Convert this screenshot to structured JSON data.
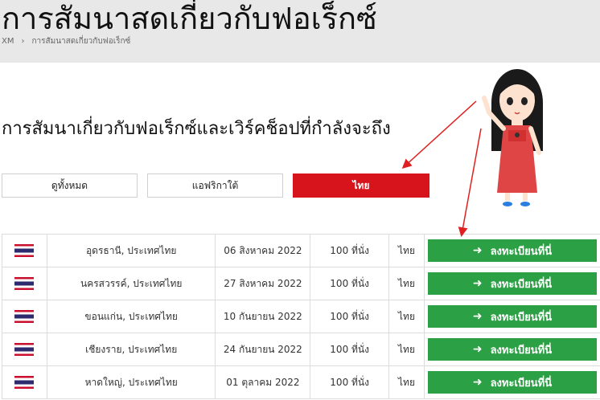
{
  "header": {
    "title": "การสัมนาสดเกี่ยวกับฟอเร็กซ์",
    "breadcrumb": [
      "XM",
      "การสัมนาสดเกี่ยวกับฟอเร็กซ์"
    ]
  },
  "section": {
    "title": "การสัมนาเกี่ยวกับฟอเร็กซ์และเวิร์คช็อปที่กำลังจะถึง"
  },
  "filters": [
    {
      "label": "ดูทั้งหมด",
      "active": false
    },
    {
      "label": "แอฟริกาใต้",
      "active": false
    },
    {
      "label": "ไทย",
      "active": true
    }
  ],
  "events": [
    {
      "location": "อุดรธานี, ประเทศไทย",
      "date": "06 สิงหาคม 2022",
      "seats": "100 ที่นั่ง",
      "language": "ไทย",
      "button": "ลงทะเบียนที่นี่"
    },
    {
      "location": "นครสวรรค์, ประเทศไทย",
      "date": "27 สิงหาคม 2022",
      "seats": "100 ที่นั่ง",
      "language": "ไทย",
      "button": "ลงทะเบียนที่นี่"
    },
    {
      "location": "ขอนแก่น, ประเทศไทย",
      "date": "10 กันยายน 2022",
      "seats": "100 ที่นั่ง",
      "language": "ไทย",
      "button": "ลงทะเบียนที่นี่"
    },
    {
      "location": "เชียงราย, ประเทศไทย",
      "date": "24 กันยายน 2022",
      "seats": "100 ที่นั่ง",
      "language": "ไทย",
      "button": "ลงทะเบียนที่นี่"
    },
    {
      "location": "หาดใหญ่, ประเทศไทย",
      "date": "01 ตุลาคม 2022",
      "seats": "100 ที่นั่ง",
      "language": "ไทย",
      "button": "ลงทะเบียนที่นี่"
    }
  ],
  "icons": {
    "flag": "thailand-flag-icon",
    "arrow": "arrow-right-icon",
    "mascot": "cartoon-girl-pointing"
  },
  "colors": {
    "active_filter": "#d7141c",
    "register_button": "#2ca044",
    "annotation_arrow": "#e02020",
    "header_bg": "#e8e8e8"
  }
}
